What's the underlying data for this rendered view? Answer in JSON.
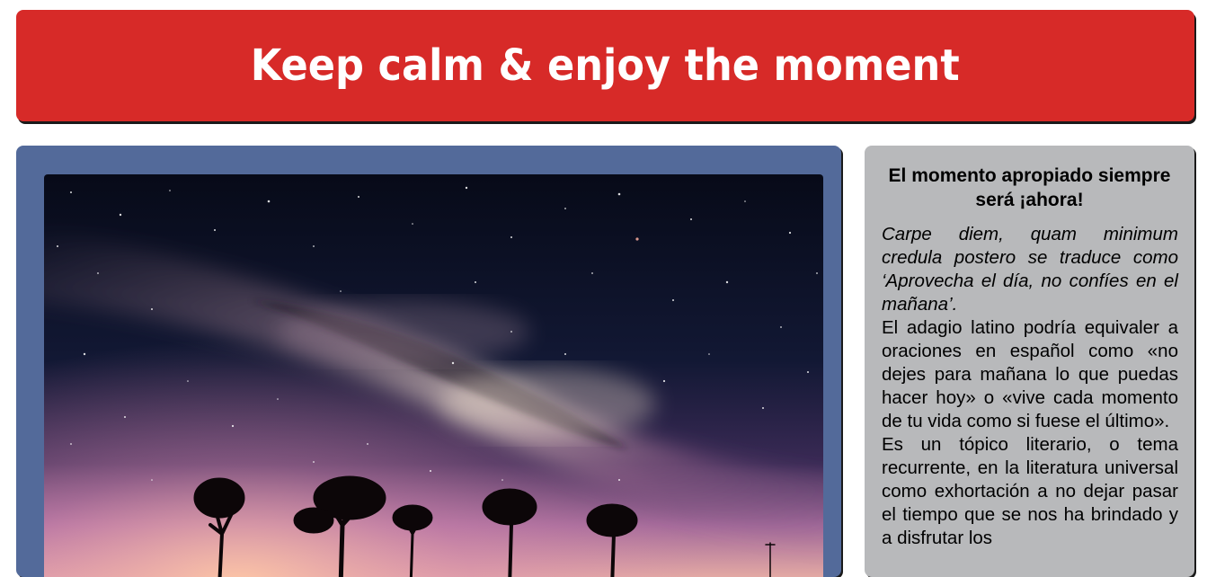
{
  "header": {
    "title": "Keep calm & enjoy the moment",
    "background_color": "#d72a28"
  },
  "main": {
    "background_color": "#536a9a",
    "image": {
      "description_icon": "milky-way-photo"
    }
  },
  "aside": {
    "background_color": "#b8b9bb",
    "heading": "El momento apropiado siempre será ¡ahora!",
    "quote": " Carpe diem, quam minimum credula postero se traduce como ‘Aprovecha el día, no confíes en el mañana’.",
    "paragraph_1": "El adagio latino podría equivaler a oraciones en español como «no dejes para mañana lo que puedas hacer hoy» o «vive cada momento de tu vida como si fuese el último».",
    "paragraph_2": "Es un tópico literario, o tema recurrente, en la literatura universal como exhortación a no dejar pasar el tiempo que se nos ha brindado y a disfrutar los"
  }
}
